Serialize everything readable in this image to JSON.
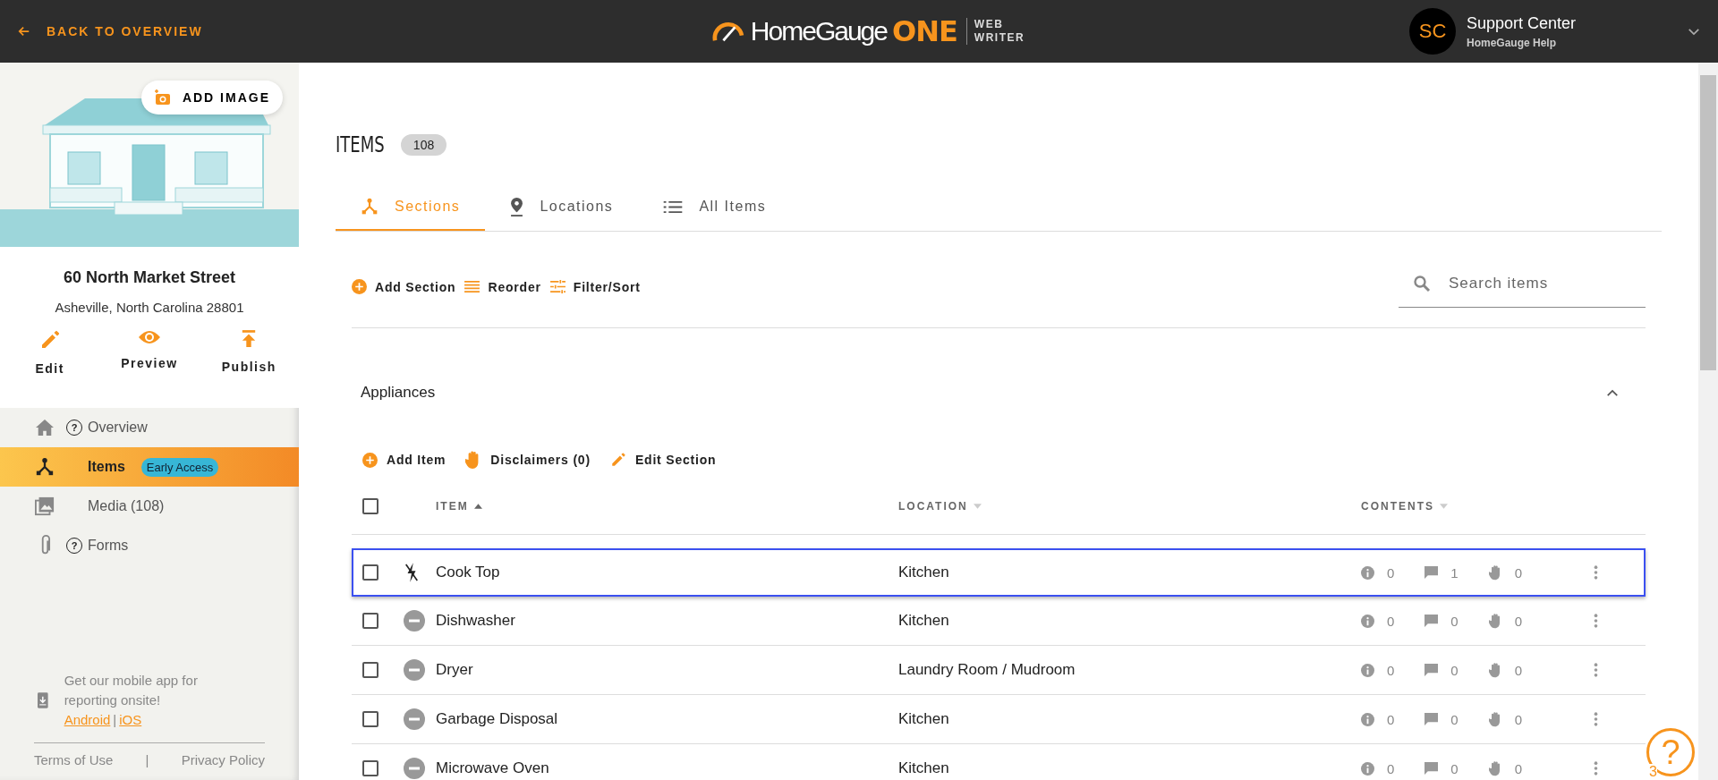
{
  "header": {
    "back_link": "BACK TO OVERVIEW",
    "logo": {
      "name": "HomeGauge",
      "accent": "ONE",
      "sub_1": "WEB",
      "sub_2": "WRITER"
    },
    "user": {
      "initials": "SC",
      "name": "Support Center",
      "subtitle": "HomeGauge Help"
    }
  },
  "sidebar": {
    "add_image": "ADD IMAGE",
    "address_1": "60 North Market Street",
    "address_2": "Asheville,  North Carolina 28801",
    "actions": [
      {
        "kind": "edit",
        "label": "Edit"
      },
      {
        "kind": "preview",
        "label": "Preview"
      },
      {
        "kind": "publish",
        "label": "Publish"
      }
    ],
    "nav": [
      {
        "kind": "home",
        "label": "Overview",
        "help": "?",
        "selected": false
      },
      {
        "kind": "items",
        "label": "Items",
        "badge": "Early Access",
        "selected": true
      },
      {
        "kind": "media",
        "label": "Media (108)",
        "selected": false
      },
      {
        "kind": "forms",
        "label": "Forms",
        "help": "?",
        "selected": false
      }
    ],
    "app_promo": "Get our mobile app for reporting onsite!",
    "android": "Android",
    "separator": "|",
    "ios": "iOS",
    "terms": "Terms of Use",
    "footer_separator": "|",
    "privacy": "Privacy Policy"
  },
  "main": {
    "title": "ITEMS",
    "count": "108",
    "tabs": [
      {
        "kind": "sections",
        "label": "Sections",
        "selected": true
      },
      {
        "kind": "locations",
        "label": "Locations",
        "selected": false
      },
      {
        "kind": "list",
        "label": "All Items",
        "selected": false
      }
    ],
    "toolbar": [
      {
        "kind": "add",
        "label": "Add Section"
      },
      {
        "kind": "reorder",
        "label": "Reorder"
      },
      {
        "kind": "filter",
        "label": "Filter/Sort"
      }
    ],
    "search": {
      "placeholder": "Search items"
    },
    "section": {
      "title": "Appliances",
      "expanded": true,
      "actions": [
        {
          "kind": "add",
          "label": "Add Item"
        },
        {
          "kind": "hand",
          "label": "Disclaimers (0)"
        },
        {
          "kind": "edit",
          "label": "Edit Section"
        }
      ],
      "select_all": {
        "checked": false
      },
      "columns": [
        {
          "label": "ITEM",
          "sorted": true
        },
        {
          "label": "LOCATION",
          "sorted": false
        },
        {
          "label": "CONTENTS",
          "sorted": false
        }
      ],
      "rows": [
        {
          "kind": "bolt",
          "item": "Cook Top",
          "location": "Kitchen",
          "info": "0",
          "comments": "1",
          "disclaimers": "0",
          "checked": false,
          "focused": true
        },
        {
          "kind": "minus",
          "item": "Dishwasher",
          "location": "Kitchen",
          "info": "0",
          "comments": "0",
          "disclaimers": "0",
          "checked": false,
          "focused": false
        },
        {
          "kind": "minus",
          "item": "Dryer",
          "location": "Laundry Room / Mudroom",
          "info": "0",
          "comments": "0",
          "disclaimers": "0",
          "checked": false,
          "focused": false
        },
        {
          "kind": "minus",
          "item": "Garbage Disposal",
          "location": "Kitchen",
          "info": "0",
          "comments": "0",
          "disclaimers": "0",
          "checked": false,
          "focused": false
        },
        {
          "kind": "minus",
          "item": "Microwave Oven",
          "location": "Kitchen",
          "info": "0",
          "comments": "0",
          "disclaimers": "0",
          "checked": false,
          "focused": false
        }
      ]
    }
  },
  "help": {
    "glyph": "?",
    "count": "3"
  }
}
